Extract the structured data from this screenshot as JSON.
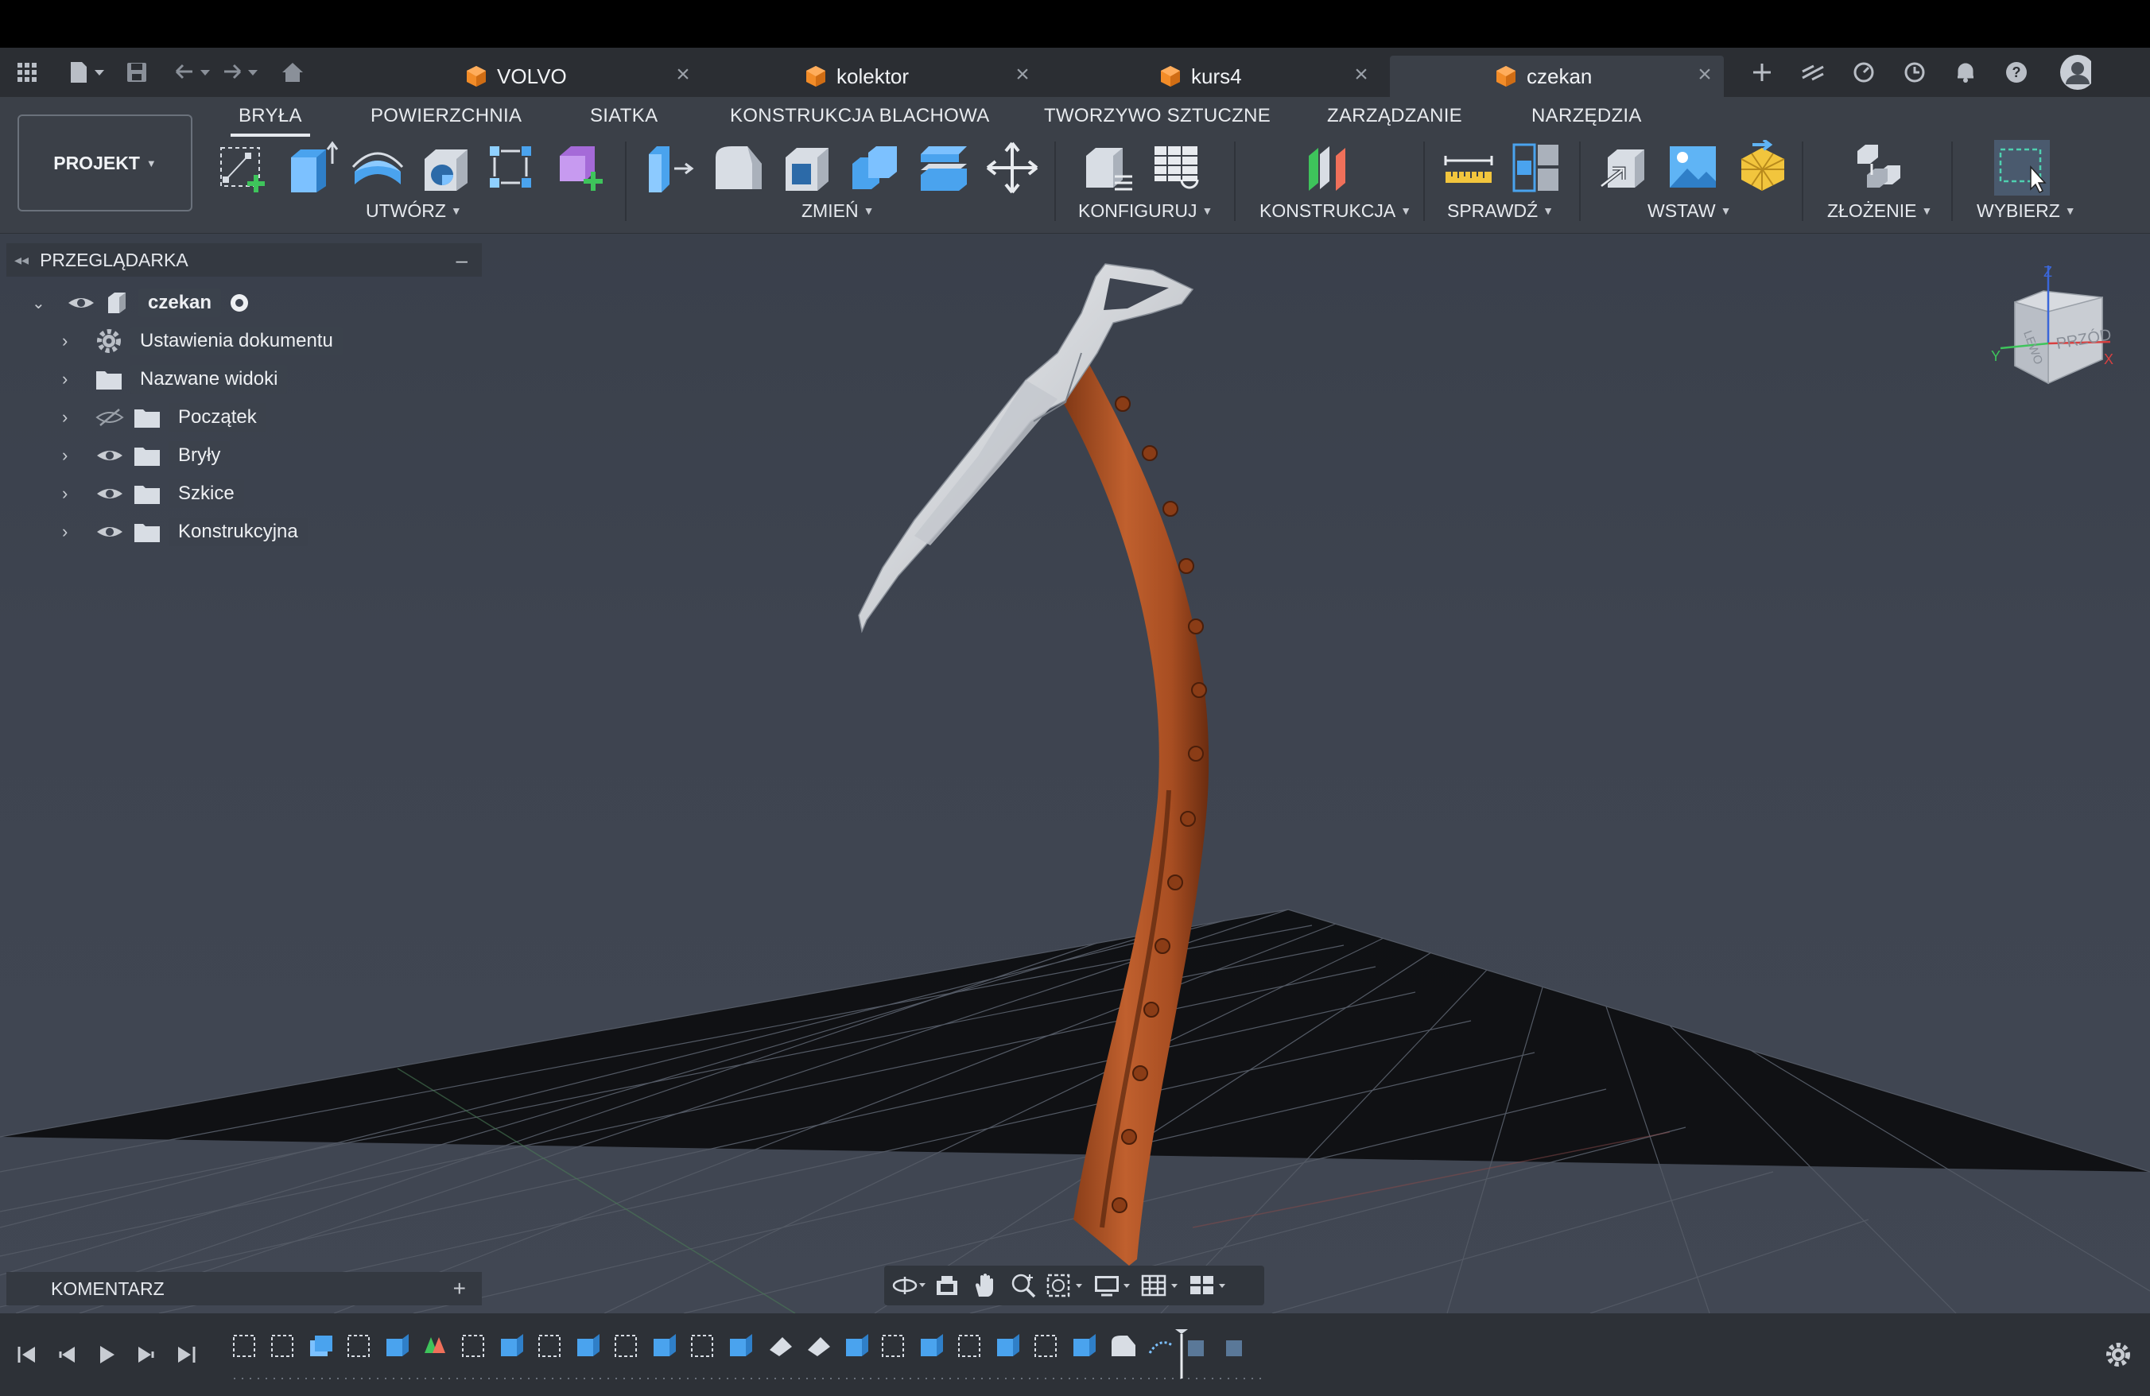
{
  "app": {
    "accent": "#f28c28",
    "ribbon_bg": "#3b4048"
  },
  "tabs": [
    {
      "label": "VOLVO",
      "icon": "cube-icon",
      "active": false
    },
    {
      "label": "kolektor",
      "icon": "cube-icon",
      "active": false
    },
    {
      "label": "kurs4",
      "icon": "cube-icon",
      "active": false
    },
    {
      "label": "czekan",
      "icon": "cube-icon",
      "active": true
    }
  ],
  "ribbon": {
    "tabs": [
      "BRYŁA",
      "POWIERZCHNIA",
      "SIATKA",
      "KONSTRUKCJA BLACHOWA",
      "TWORZYWO SZTUCZNE",
      "ZARZĄDZANIE",
      "NARZĘDZIA"
    ],
    "selected_tab": "BRYŁA",
    "project_label": "PROJEKT",
    "groups": [
      "UTWÓRZ",
      "ZMIEŃ",
      "KONFIGURUJ",
      "KONSTRUKCJA",
      "SPRAWDŹ",
      "WSTAW",
      "ZŁOŻENIE",
      "WYBIERZ"
    ]
  },
  "browser": {
    "title": "PRZEGLĄDARKA",
    "root": "czekan",
    "items": [
      {
        "label": "Ustawienia dokumentu",
        "icon": "gear-icon"
      },
      {
        "label": "Nazwane widoki",
        "icon": "folder-icon"
      },
      {
        "label": "Początek",
        "icon": "folder-icon",
        "hidden": true
      },
      {
        "label": "Bryły",
        "icon": "folder-icon"
      },
      {
        "label": "Szkice",
        "icon": "folder-icon"
      },
      {
        "label": "Konstrukcyjna",
        "icon": "folder-icon"
      }
    ]
  },
  "comment": {
    "label": "KOMENTARZ"
  },
  "viewcube": {
    "face_left": "LEWO",
    "face_front": "PRZÓD",
    "axis_x": "X",
    "axis_y": "Y",
    "axis_z": "Z"
  }
}
